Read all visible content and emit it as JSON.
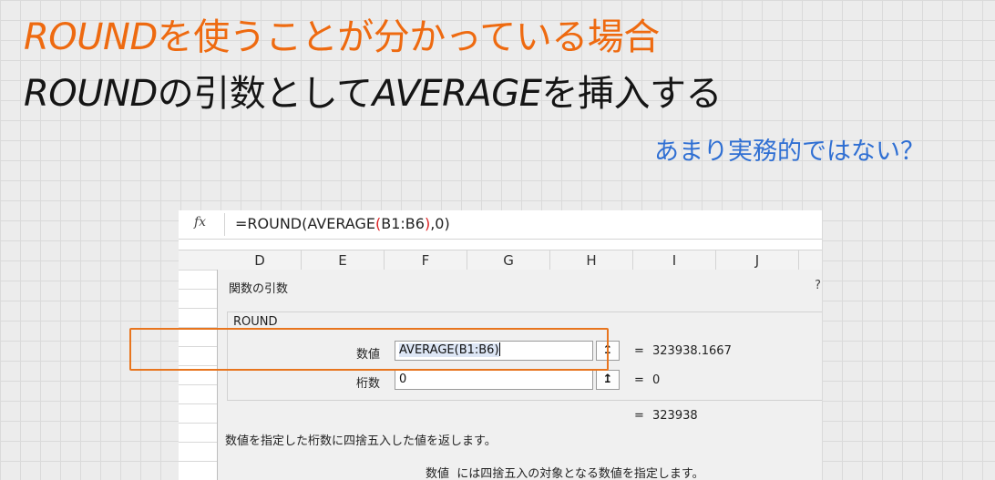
{
  "slide": {
    "title_line1_en": "ROUND",
    "title_line1_ja": "を使うことが分かっている場合",
    "title_line2_en1": "ROUND",
    "title_line2_ja1": "の引数として",
    "title_line2_en2": "AVERAGE",
    "title_line2_ja2": "を挿入する",
    "note": "あまり実務的ではない？"
  },
  "formula_bar": {
    "fx_icon": "fx",
    "part1": "=ROUND(AVERAGE",
    "paren_open": "(",
    "range": "B1:B6",
    "paren_close": ")",
    "part2": ",0)"
  },
  "columns": [
    "D",
    "E",
    "F",
    "G",
    "H",
    "I",
    "J"
  ],
  "dialog": {
    "title": "関数の引数",
    "help": "?",
    "function_name": "ROUND",
    "args": [
      {
        "label": "数値",
        "value": "AVERAGE(B1:B6)",
        "equals": "=",
        "result": "323938.1667",
        "ref_icon": "↥"
      },
      {
        "label": "桁数",
        "value": "0",
        "equals": "=",
        "result": "0",
        "ref_icon": "↥"
      }
    ],
    "total_equals": "=",
    "total_result": "323938",
    "description": "数値を指定した桁数に四捨五入した値を返します。",
    "arg_desc_name": "数値",
    "arg_desc_text": "には四捨五入の対象となる数値を指定します。"
  },
  "colors": {
    "title_orange": "#ee6a10",
    "note_blue": "#2f6fd3",
    "highlight_orange": "#e8751e"
  }
}
